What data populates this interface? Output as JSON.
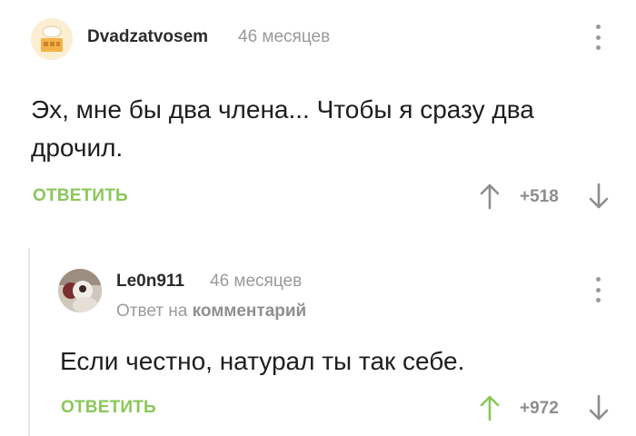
{
  "comments": [
    {
      "author": "Dvadzatvosem",
      "time": "46 месяцев",
      "text": "Эх, мне бы два члена... Чтобы я сразу два дрочил.",
      "reply_label": "ОТВЕТИТЬ",
      "rating": "+518",
      "upvoted": false
    },
    {
      "author": "Le0n911",
      "time": "46 месяцев",
      "reply_prefix": "Ответ на",
      "reply_target": "комментарий",
      "text": "Если честно, натурал ты так себе.",
      "reply_label": "ОТВЕТИТЬ",
      "rating": "+972",
      "upvoted": true
    }
  ],
  "colors": {
    "accent_green": "#8ac858",
    "muted_gray": "#9a9a9a",
    "text": "#1e1e1e"
  },
  "icons": {
    "upvote": "arrow-up-icon",
    "downvote": "arrow-down-icon",
    "more": "kebab-menu-icon"
  }
}
